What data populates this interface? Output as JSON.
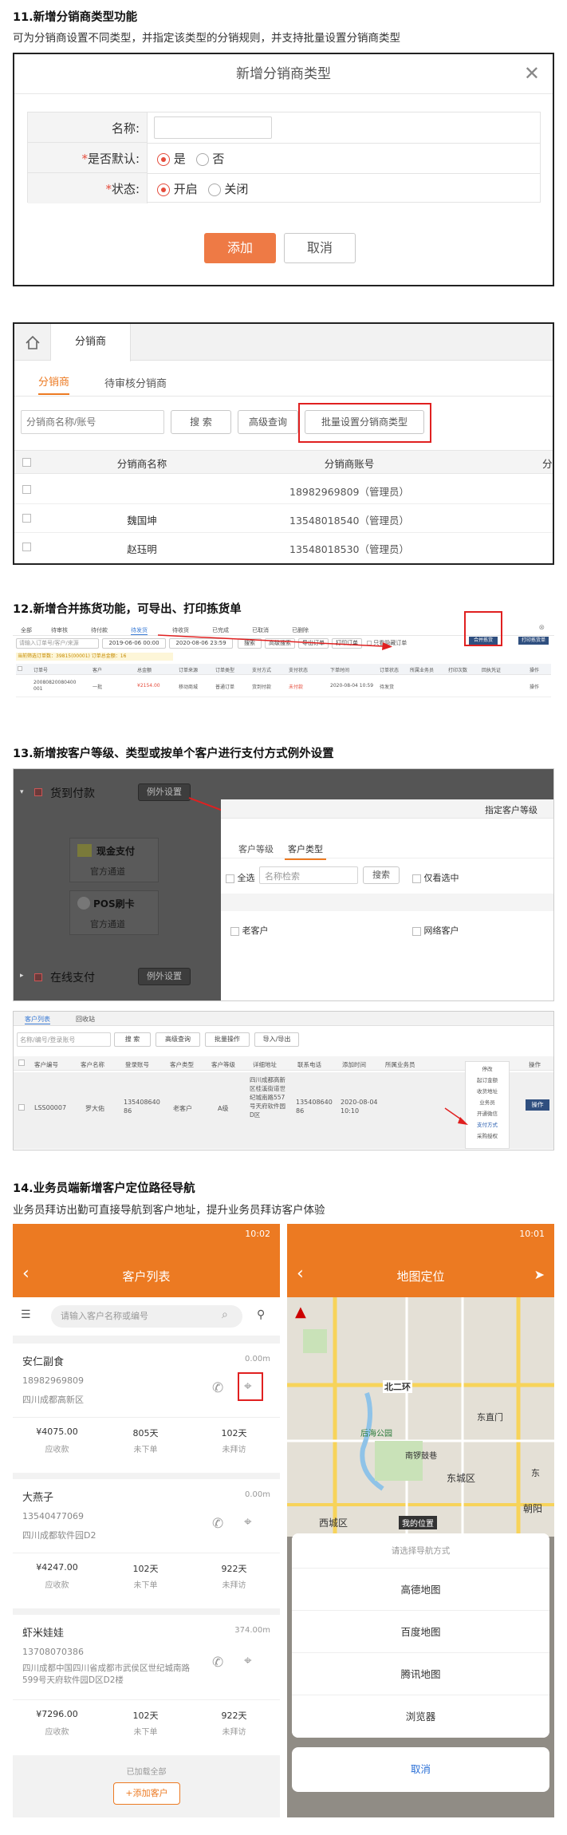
{
  "s11": {
    "title": "11.新增分销商类型功能",
    "desc": "可为分销商设置不同类型，并指定该类型的分销规则，并支持批量设置分销商类型",
    "dialog": {
      "title": "新增分销商类型",
      "name_label": "名称:",
      "default_label": "是否默认:",
      "status_label": "状态:",
      "yes": "是",
      "no": "否",
      "on": "开启",
      "off": "关闭",
      "add": "添加",
      "cancel": "取消"
    },
    "list": {
      "tab_main": "分销商",
      "sub_tabs": [
        "分销商",
        "待审核分销商"
      ],
      "search_placeholder": "分销商名称/账号",
      "search_btn": "搜 索",
      "adv_btn": "高级查询",
      "batch_btn": "批量设置分销商类型",
      "col_name": "分销商名称",
      "col_account": "分销商账号",
      "col_more": "分",
      "rows": [
        {
          "name": "",
          "account": "18982969809（管理员）"
        },
        {
          "name": "魏国坤",
          "account": "13548018540（管理员）"
        },
        {
          "name": "赵珏明",
          "account": "13548018530（管理员）"
        }
      ]
    }
  },
  "s12": {
    "title": "12.新增合并拣货功能，可导出、打印拣货单",
    "tabs": [
      "全部",
      "待审核",
      "待付款",
      "待发货",
      "待收货",
      "已完成",
      "已取消",
      "已删除"
    ],
    "search_placeholder": "请输入订单号/客户/来源",
    "date_from": "2019-06-06 00:00",
    "date_to": "2020-08-06 23:59",
    "search_btn": "搜索",
    "adv_btn": "高级搜索",
    "export_btn": "导出订单",
    "print_btn": "打印订单",
    "only_hidden": "只看隐藏订单",
    "merge_btn": "合并拣货",
    "export_pick_btn": "打印拣货单",
    "stat_text": "当前筛选订单数：39815(00001) 订单总金额：16",
    "headers": [
      "订单号",
      "客户",
      "总金额",
      "订单来源",
      "订单类型",
      "支付方式",
      "支付状态",
      "下单时间",
      "订单状态",
      "所属业务员",
      "打印次数",
      "回执凭证",
      "操作"
    ],
    "row": [
      "20080820080400 001",
      "一批",
      "¥2154.00",
      "移动商城",
      "普通订单",
      "货到付款",
      "未付款",
      "2020-08-04 10:59",
      "待发货",
      "",
      "",
      "",
      "操作"
    ]
  },
  "s13": {
    "title": "13.新增按客户等级、类型或按单个客户进行支付方式例外设置",
    "pay": {
      "cod": "货到付款",
      "exception_btn": "例外设置",
      "cash": "现金支付",
      "pos": "POS刷卡",
      "channel": "官方通道",
      "online": "在线支付"
    },
    "panel": {
      "title": "指定客户等级",
      "tabs": [
        "客户等级",
        "客户类型"
      ],
      "select_all": "全选",
      "search_placeholder": "名称检索",
      "search_btn": "搜索",
      "only_selected": "仅看选中",
      "options": [
        "老客户",
        "网络客户"
      ]
    },
    "cust": {
      "tabs": [
        "客户列表",
        "回收站"
      ],
      "search_placeholder": "名称/编号/登录账号",
      "btns": [
        "搜 索",
        "高级查询",
        "批量操作",
        "导入/导出"
      ],
      "headers": [
        "客户编号",
        "客户名称",
        "登录账号",
        "客户类型",
        "客户等级",
        "详细地址",
        "联系电话",
        "添加时间",
        "所属业务员",
        "操作"
      ],
      "row": {
        "code": "LSS00007",
        "name": "罗大佑",
        "account": "13540864086",
        "type": "老客户",
        "level": "A级",
        "address": "四川成都高新区桂溪街道世纪城南路557号天府软件园D区",
        "phone": "13540864086",
        "time": "2020-08-04 10:10",
        "op": "操作"
      },
      "menu": [
        "停改",
        "起订金额",
        "收货地址",
        "业务员",
        "开通微信",
        "支付方式",
        "采购授权"
      ]
    }
  },
  "s14": {
    "title": "14.业务员端新增客户定位路径导航",
    "desc": "业务员拜访出勤可直接导航到客户地址，提升业务员拜访客户体验",
    "left": {
      "time": "10:02",
      "title": "客户列表",
      "search_placeholder": "请输入客户名称或编号",
      "customers": [
        {
          "name": "安仁副食",
          "dist": "0.00m",
          "phone": "18982969809",
          "addr": "四川成都高新区",
          "amount": "¥4075.00",
          "days_order": "805天",
          "days_visit": "102天"
        },
        {
          "name": "大燕子",
          "dist": "0.00m",
          "phone": "13540477069",
          "addr": "四川成都软件园D2",
          "amount": "¥4247.00",
          "days_order": "102天",
          "days_visit": "922天"
        },
        {
          "name": "虾米娃娃",
          "dist": "374.00m",
          "phone": "13708070386",
          "addr": "四川成都中国四川省成都市武侯区世纪城南路599号天府软件园D区D2楼",
          "amount": "¥7296.00",
          "days_order": "102天",
          "days_visit": "922天"
        }
      ],
      "lbl_amount": "应收款",
      "lbl_order": "未下单",
      "lbl_visit": "未拜访",
      "footer": "已加载全部",
      "add_btn": "+添加客户"
    },
    "right": {
      "time": "10:01",
      "title": "地图定位",
      "map_labels": [
        "北二环",
        "东直门",
        "后海公园",
        "南锣鼓巷",
        "东城区",
        "西城区",
        "朝阳",
        "东",
        "我的位置"
      ],
      "sheet_title": "请选择导航方式",
      "options": [
        "高德地图",
        "百度地图",
        "腾讯地图",
        "浏览器"
      ],
      "cancel": "取消"
    }
  }
}
